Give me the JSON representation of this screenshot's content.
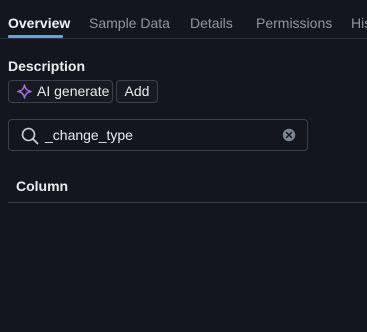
{
  "tabs": [
    {
      "label": "Overview",
      "active": true
    },
    {
      "label": "Sample Data",
      "active": false
    },
    {
      "label": "Details",
      "active": false
    },
    {
      "label": "Permissions",
      "active": false
    },
    {
      "label": "His",
      "active": false
    }
  ],
  "description": {
    "label": "Description",
    "ai_generate_label": "AI generate",
    "add_label": "Add"
  },
  "search": {
    "value": "_change_type"
  },
  "table": {
    "columns": [
      "Column"
    ]
  },
  "colors": {
    "background": "#13171d",
    "accent": "#5fa3e6",
    "ai_sparkle_start": "#e060d0",
    "ai_sparkle_end": "#7a7cf0"
  },
  "icons": {
    "ai": "sparkle-icon",
    "search": "search-icon",
    "clear": "clear-icon"
  }
}
